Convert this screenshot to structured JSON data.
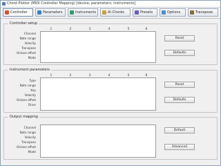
{
  "window": {
    "title": "Chord Plotter (MIDI Controller Mapping) [device, parameters, instruments]"
  },
  "toolbar": {
    "buttons": [
      {
        "label": "Controller",
        "color": "#d9502e"
      },
      {
        "label": "Parameters",
        "color": "#3d7dc9"
      },
      {
        "label": "Instruments",
        "color": "#2f9e6b"
      },
      {
        "label": "AI Chords",
        "color": "#c9a23d"
      },
      {
        "label": "Presets",
        "color": "#6a5acd"
      },
      {
        "label": "Options",
        "color": "#4a8fc7"
      },
      {
        "label": "Transpose",
        "color": "#8a6b3d"
      }
    ]
  },
  "sections": [
    {
      "title": "Controller setup",
      "columns": [
        "1",
        "2",
        "3",
        "4",
        "5",
        "6"
      ],
      "rows": [
        "Channel",
        "Note range",
        "Velocity",
        "Transpose",
        "Octave offset",
        "Mode"
      ],
      "buttons": [
        "Reset",
        "Defaults"
      ]
    },
    {
      "title": "Instrument parameters",
      "columns": [
        "1",
        "2",
        "3",
        "4",
        "5",
        "6"
      ],
      "rows": [
        "Type",
        "Note range",
        "Key",
        "Velocity",
        "Octave offset",
        "Drive"
      ],
      "buttons": [
        "Reset",
        "Defaults"
      ]
    },
    {
      "title": "Output mapping",
      "columns": [
        "",
        "",
        "",
        "",
        "",
        ""
      ],
      "rows": [
        "Channel",
        "Note range",
        "Velocity",
        "Transpose",
        "Octave offset",
        "Mode"
      ],
      "buttons": [
        "Default",
        "Advanced"
      ]
    }
  ]
}
